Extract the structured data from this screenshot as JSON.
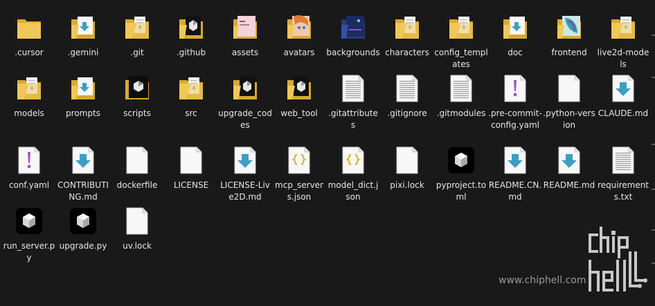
{
  "files": [
    {
      "label": ".cursor",
      "type": "folder"
    },
    {
      "label": ".gemini",
      "type": "folder-download"
    },
    {
      "label": ".git",
      "type": "folder-docs"
    },
    {
      "label": ".github",
      "type": "folder-github"
    },
    {
      "label": "assets",
      "type": "folder-pink"
    },
    {
      "label": "avatars",
      "type": "folder-anime"
    },
    {
      "label": "backgrounds",
      "type": "folder-night"
    },
    {
      "label": "characters",
      "type": "folder-docs"
    },
    {
      "label": "config_templates",
      "type": "folder-docs"
    },
    {
      "label": "doc",
      "type": "folder-download"
    },
    {
      "label": "frontend",
      "type": "folder-teal"
    },
    {
      "label": "live2d-models",
      "type": "folder-docs"
    },
    {
      "label": "models",
      "type": "folder-docs"
    },
    {
      "label": "prompts",
      "type": "folder-download"
    },
    {
      "label": "scripts",
      "type": "folder-dark"
    },
    {
      "label": "src",
      "type": "folder-docs"
    },
    {
      "label": "upgrade_codes",
      "type": "folder-github"
    },
    {
      "label": "web_tool",
      "type": "folder-github"
    },
    {
      "label": ".gitattributes",
      "type": "text-file"
    },
    {
      "label": ".gitignore",
      "type": "text-file"
    },
    {
      "label": ".gitmodules",
      "type": "text-file"
    },
    {
      "label": ".pre-commit-config.yaml",
      "type": "yaml-file"
    },
    {
      "label": ".python-version",
      "type": "blank-file"
    },
    {
      "label": "CLAUDE.md",
      "type": "md-file"
    },
    {
      "label": "conf.yaml",
      "type": "yaml-file"
    },
    {
      "label": "CONTRIBUTING.md",
      "type": "md-file"
    },
    {
      "label": "dockerfile",
      "type": "blank-file"
    },
    {
      "label": "LICENSE",
      "type": "blank-file"
    },
    {
      "label": "LICENSE-Live2D.md",
      "type": "md-file"
    },
    {
      "label": "mcp_servers.json",
      "type": "json-file"
    },
    {
      "label": "model_dict.json",
      "type": "json-file"
    },
    {
      "label": "pixi.lock",
      "type": "blank-file"
    },
    {
      "label": "pyproject.toml",
      "type": "app-icon"
    },
    {
      "label": "README.CN.md",
      "type": "md-file"
    },
    {
      "label": "README.md",
      "type": "md-file"
    },
    {
      "label": "requirements.txt",
      "type": "text-file"
    },
    {
      "label": "run_server.py",
      "type": "app-icon"
    },
    {
      "label": "upgrade.py",
      "type": "app-icon"
    },
    {
      "label": "uv.lock",
      "type": "blank-file"
    }
  ],
  "watermark": {
    "url": "www.chiphell.com",
    "logo": "chip hell"
  },
  "colors": {
    "background": "#191919",
    "label": "#e6e6e6",
    "folder": "#f0c859",
    "folder_back": "#d9a935",
    "md_arrow": "#3b9fc2",
    "yaml_mark": "#9a56c0",
    "json_brace": "#d8b23a"
  }
}
